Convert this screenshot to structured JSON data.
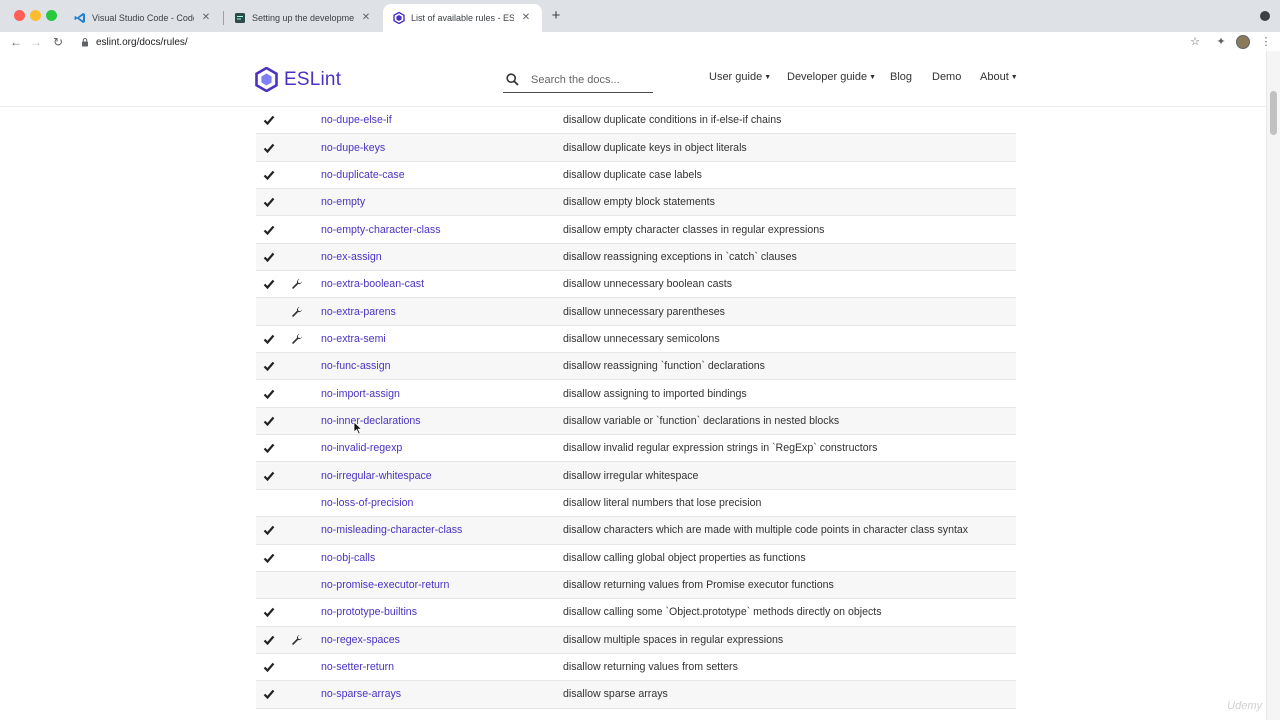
{
  "browser": {
    "tabs": [
      {
        "title": "Visual Studio Code - Code Editi",
        "active": false
      },
      {
        "title": "Setting up the development en",
        "active": false
      },
      {
        "title": "List of available rules - ESLint",
        "active": true
      }
    ],
    "address": "eslint.org/docs/rules/"
  },
  "site": {
    "logo_text": "ESLint",
    "search_placeholder": "Search the docs...",
    "nav": {
      "user_guide": "User guide",
      "developer_guide": "Developer guide",
      "blog": "Blog",
      "demo": "Demo",
      "about": "About"
    }
  },
  "rules": [
    {
      "name": "no-dupe-else-if",
      "desc": "disallow duplicate conditions in if-else-if chains",
      "recommended": true,
      "fixable": false
    },
    {
      "name": "no-dupe-keys",
      "desc": "disallow duplicate keys in object literals",
      "recommended": true,
      "fixable": false
    },
    {
      "name": "no-duplicate-case",
      "desc": "disallow duplicate case labels",
      "recommended": true,
      "fixable": false
    },
    {
      "name": "no-empty",
      "desc": "disallow empty block statements",
      "recommended": true,
      "fixable": false
    },
    {
      "name": "no-empty-character-class",
      "desc": "disallow empty character classes in regular expressions",
      "recommended": true,
      "fixable": false
    },
    {
      "name": "no-ex-assign",
      "desc": "disallow reassigning exceptions in `catch` clauses",
      "recommended": true,
      "fixable": false
    },
    {
      "name": "no-extra-boolean-cast",
      "desc": "disallow unnecessary boolean casts",
      "recommended": true,
      "fixable": true
    },
    {
      "name": "no-extra-parens",
      "desc": "disallow unnecessary parentheses",
      "recommended": false,
      "fixable": true
    },
    {
      "name": "no-extra-semi",
      "desc": "disallow unnecessary semicolons",
      "recommended": true,
      "fixable": true
    },
    {
      "name": "no-func-assign",
      "desc": "disallow reassigning `function` declarations",
      "recommended": true,
      "fixable": false
    },
    {
      "name": "no-import-assign",
      "desc": "disallow assigning to imported bindings",
      "recommended": true,
      "fixable": false
    },
    {
      "name": "no-inner-declarations",
      "desc": "disallow variable or `function` declarations in nested blocks",
      "recommended": true,
      "fixable": false
    },
    {
      "name": "no-invalid-regexp",
      "desc": "disallow invalid regular expression strings in `RegExp` constructors",
      "recommended": true,
      "fixable": false
    },
    {
      "name": "no-irregular-whitespace",
      "desc": "disallow irregular whitespace",
      "recommended": true,
      "fixable": false
    },
    {
      "name": "no-loss-of-precision",
      "desc": "disallow literal numbers that lose precision",
      "recommended": false,
      "fixable": false
    },
    {
      "name": "no-misleading-character-class",
      "desc": "disallow characters which are made with multiple code points in character class syntax",
      "recommended": true,
      "fixable": false
    },
    {
      "name": "no-obj-calls",
      "desc": "disallow calling global object properties as functions",
      "recommended": true,
      "fixable": false
    },
    {
      "name": "no-promise-executor-return",
      "desc": "disallow returning values from Promise executor functions",
      "recommended": false,
      "fixable": false
    },
    {
      "name": "no-prototype-builtins",
      "desc": "disallow calling some `Object.prototype` methods directly on objects",
      "recommended": true,
      "fixable": false
    },
    {
      "name": "no-regex-spaces",
      "desc": "disallow multiple spaces in regular expressions",
      "recommended": true,
      "fixable": true
    },
    {
      "name": "no-setter-return",
      "desc": "disallow returning values from setters",
      "recommended": true,
      "fixable": false
    },
    {
      "name": "no-sparse-arrays",
      "desc": "disallow sparse arrays",
      "recommended": true,
      "fixable": false
    }
  ],
  "watermark": "Udemy",
  "colors": {
    "brand": "#4b32c3",
    "link": "#4b32c3"
  }
}
